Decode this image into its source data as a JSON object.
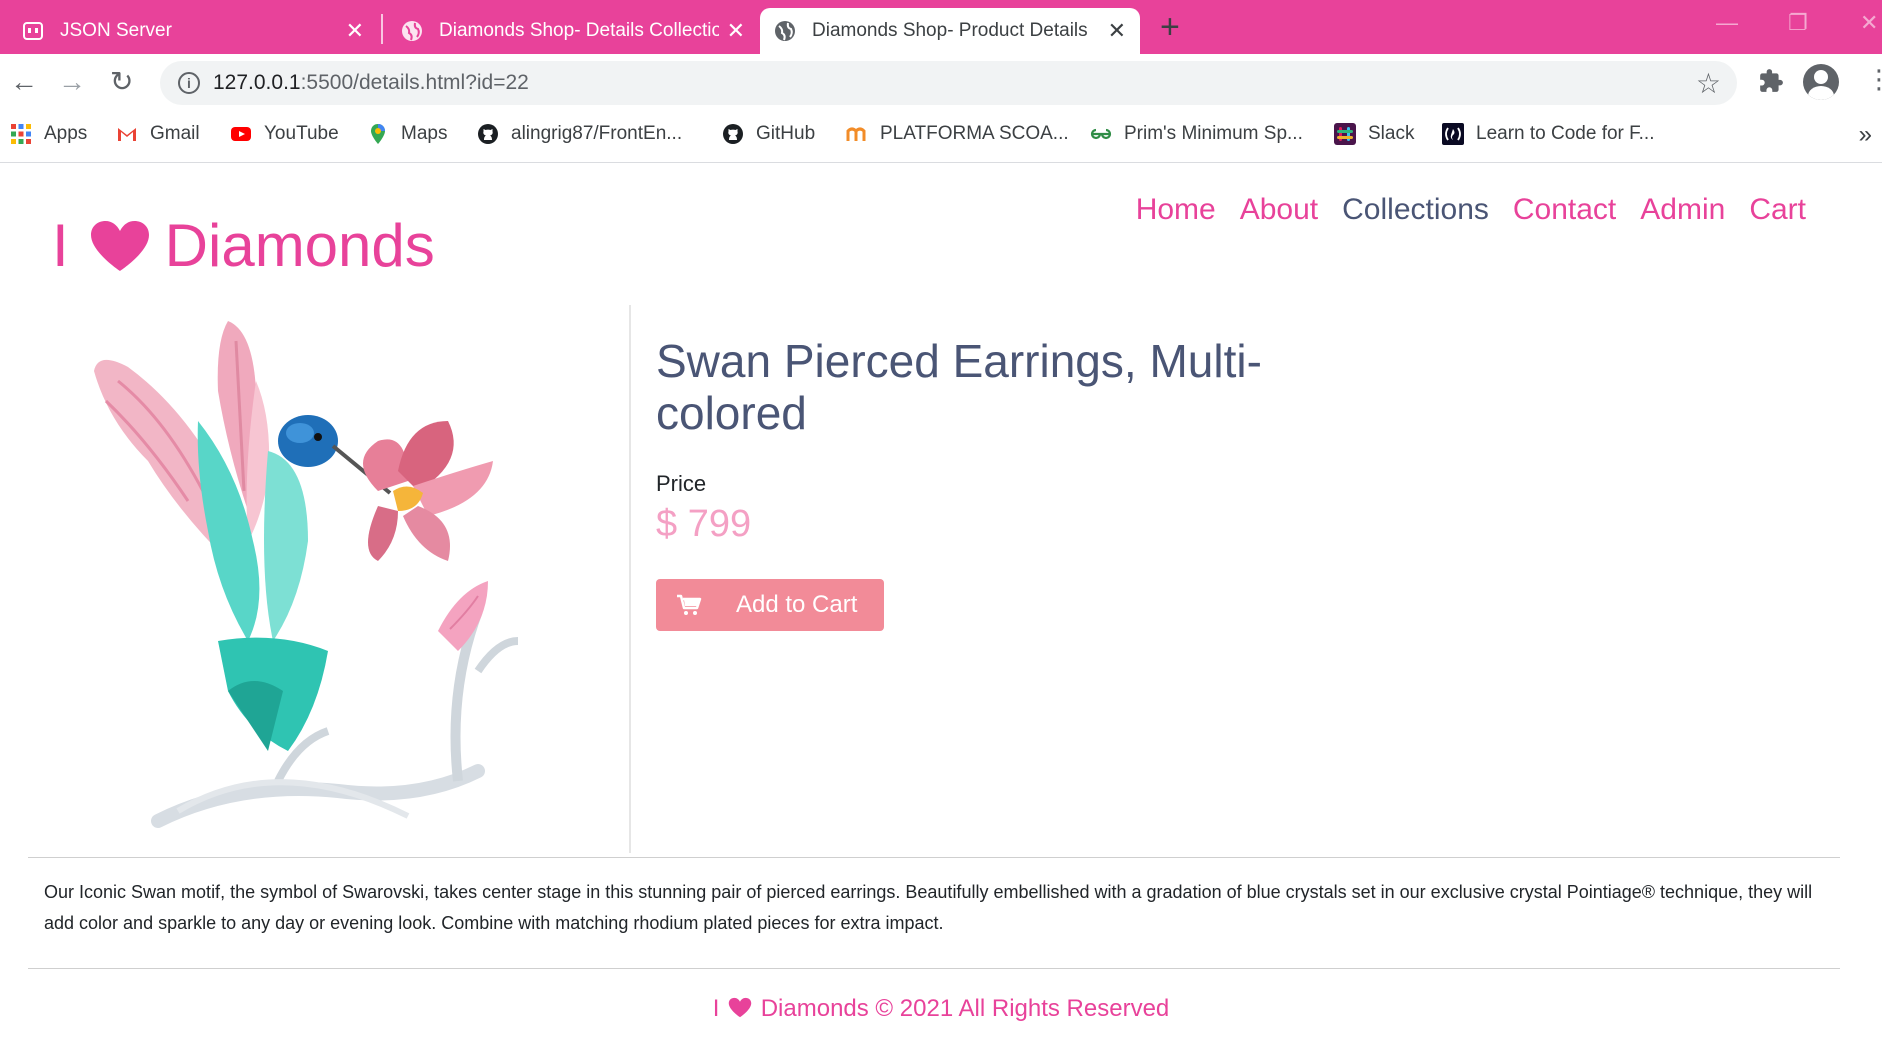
{
  "browser": {
    "tabs": [
      {
        "title": "JSON Server",
        "icon": "json-server-icon"
      },
      {
        "title": "Diamonds Shop- Details Collection",
        "icon": "globe-icon"
      },
      {
        "title": "Diamonds Shop- Product Details",
        "icon": "globe-icon",
        "active": true
      }
    ],
    "new_tab": "+",
    "url_host": "127.0.0.1",
    "url_path": ":5500/details.html?id=22",
    "bookmarks": [
      {
        "label": "Apps",
        "icon": "apps-grid-icon"
      },
      {
        "label": "Gmail",
        "icon": "gmail-icon"
      },
      {
        "label": "YouTube",
        "icon": "youtube-icon"
      },
      {
        "label": "Maps",
        "icon": "maps-icon"
      },
      {
        "label": "alingrig87/FrontEn...",
        "icon": "github-icon"
      },
      {
        "label": "GitHub",
        "icon": "github-icon"
      },
      {
        "label": "PLATFORMA SCOA...",
        "icon": "platforma-icon"
      },
      {
        "label": "Prim's Minimum Sp...",
        "icon": "geeksforgeeks-icon"
      },
      {
        "label": "Slack",
        "icon": "slack-icon"
      },
      {
        "label": "Learn to Code for F...",
        "icon": "freecodecamp-icon"
      }
    ],
    "bookmarks_more": "»"
  },
  "site": {
    "logo_prefix": "I",
    "logo_suffix": "Diamonds",
    "nav": [
      "Home",
      "About",
      "Collections",
      "Contact",
      "Admin",
      "Cart"
    ],
    "nav_current": "Collections"
  },
  "product": {
    "title": "Swan Pierced Earrings, Multi-colored",
    "price_label": "Price",
    "price": "$ 799",
    "add_to_cart": "Add to Cart",
    "description": "Our Iconic Swan motif, the symbol of Swarovski, takes center stage in this stunning pair of pierced earrings. Beautifully embellished with a gradation of blue crystals set in our exclusive crystal Pointiage® technique, they will add color and sparkle to any day or evening look. Combine with matching rhodium plated pieces for extra impact."
  },
  "footer": {
    "prefix": "I",
    "text": "Diamonds © 2021 All Rights Reserved"
  },
  "colors": {
    "brand_pink": "#e8429a",
    "nav_active": "#4a5575",
    "price": "#f4a0c4",
    "button": "#f28b98"
  }
}
